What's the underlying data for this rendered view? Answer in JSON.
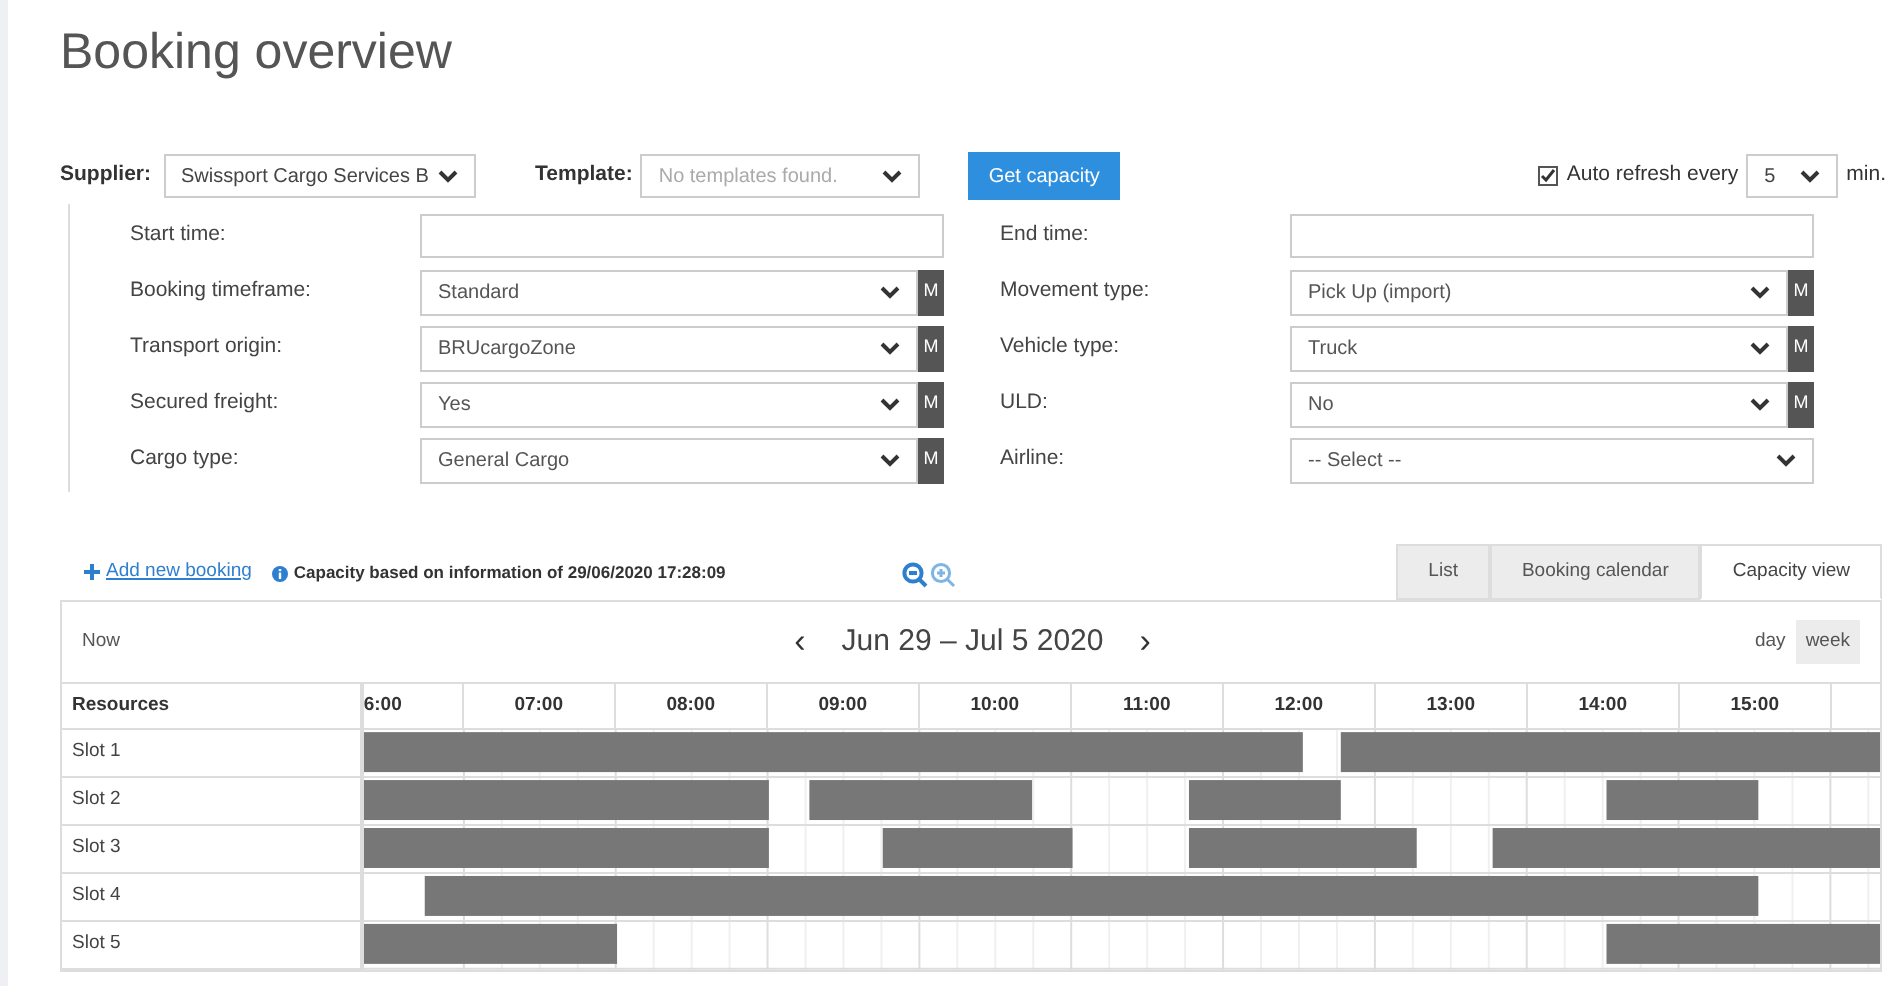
{
  "title": "Booking overview",
  "supplier": {
    "label": "Supplier:",
    "value": "Swissport Cargo Services B"
  },
  "template": {
    "label": "Template:",
    "value": "No templates found.",
    "disabled": true
  },
  "get_capacity": "Get capacity",
  "auto_refresh": {
    "checked": true,
    "label": "Auto refresh every",
    "value": "5",
    "unit": "min."
  },
  "fields": [
    {
      "label": "Start time:",
      "kind": "text"
    },
    {
      "label": "End time:",
      "kind": "text"
    },
    {
      "label": "Booking timeframe:",
      "kind": "select",
      "value": "Standard",
      "badge": "M"
    },
    {
      "label": "Movement type:",
      "kind": "select",
      "value": "Pick Up (import)",
      "badge": "M"
    },
    {
      "label": "Transport origin:",
      "kind": "select",
      "value": "BRUcargoZone",
      "badge": "M"
    },
    {
      "label": "Vehicle type:",
      "kind": "select",
      "value": "Truck",
      "badge": "M"
    },
    {
      "label": "Secured freight:",
      "kind": "select",
      "value": "Yes",
      "badge": "M"
    },
    {
      "label": "ULD:",
      "kind": "select",
      "value": "No",
      "badge": "M"
    },
    {
      "label": "Cargo type:",
      "kind": "select",
      "value": "General Cargo",
      "badge": "M"
    },
    {
      "label": "Airline:",
      "kind": "select",
      "value": "-- Select --"
    }
  ],
  "add_booking": "Add new booking",
  "capacity_info": "Capacity based on information of 29/06/2020 17:28:09",
  "tabs": [
    {
      "label": "List",
      "selected": false
    },
    {
      "label": "Booking calendar",
      "selected": false
    },
    {
      "label": "Capacity view",
      "selected": true
    }
  ],
  "calendar": {
    "now": "Now",
    "prev": "‹",
    "range": "Jun 29 – Jul 5 2020",
    "next": "›",
    "views": [
      {
        "label": "day",
        "selected": false
      },
      {
        "label": "week",
        "selected": true
      }
    ],
    "resources_header": "Resources",
    "hours": [
      "6:00",
      "07:00",
      "08:00",
      "09:00",
      "10:00",
      "11:00",
      "12:00",
      "13:00",
      "14:00",
      "15:00"
    ],
    "slots": [
      "Slot 1",
      "Slot 2",
      "Slot 3",
      "Slot 4",
      "Slot 5"
    ]
  }
}
